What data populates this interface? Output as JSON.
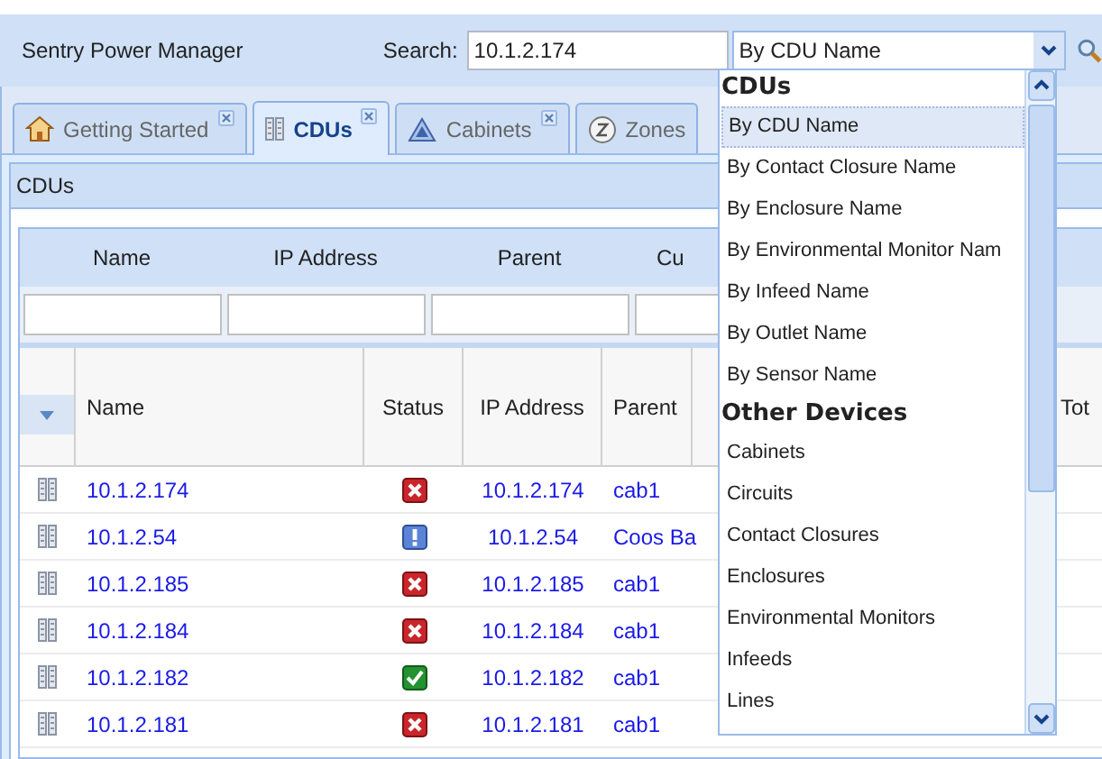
{
  "app_title": "Sentry Power Manager",
  "search": {
    "label": "Search:",
    "value": "10.1.2.174"
  },
  "search_type": {
    "value": "By CDU Name"
  },
  "tabs": [
    {
      "label": "Getting Started",
      "kind": "home",
      "selected": false
    },
    {
      "label": "CDUs",
      "kind": "cdu",
      "selected": true
    },
    {
      "label": "Cabinets",
      "kind": "cabinet",
      "selected": false
    },
    {
      "label": "Zones",
      "kind": "zone",
      "selected": false
    }
  ],
  "panel": {
    "title": "CDUs"
  },
  "filter_columns": [
    "Name",
    "IP Address",
    "Parent",
    "Cu"
  ],
  "grid_columns": [
    "Name",
    "Status",
    "IP Address",
    "Parent",
    "Tot"
  ],
  "rows": [
    {
      "name": "10.1.2.174",
      "kind": "error",
      "ip": "10.1.2.174",
      "parent": "cab1"
    },
    {
      "name": "10.1.2.54",
      "kind": "info",
      "ip": "10.1.2.54",
      "parent": "Coos Ba"
    },
    {
      "name": "10.1.2.185",
      "kind": "error",
      "ip": "10.1.2.185",
      "parent": "cab1"
    },
    {
      "name": "10.1.2.184",
      "kind": "error",
      "ip": "10.1.2.184",
      "parent": "cab1"
    },
    {
      "name": "10.1.2.182",
      "kind": "ok",
      "ip": "10.1.2.182",
      "parent": "cab1"
    },
    {
      "name": "10.1.2.181",
      "kind": "error",
      "ip": "10.1.2.181",
      "parent": "cab1"
    }
  ],
  "dropdown": {
    "groups": [
      {
        "title": "CDUs",
        "items": [
          {
            "label": "By CDU Name",
            "selected": true
          },
          {
            "label": "By Contact Closure Name",
            "selected": false
          },
          {
            "label": "By Enclosure Name",
            "selected": false
          },
          {
            "label": "By Environmental Monitor Nam",
            "selected": false
          },
          {
            "label": "By Infeed Name",
            "selected": false
          },
          {
            "label": "By Outlet Name",
            "selected": false
          },
          {
            "label": "By Sensor Name",
            "selected": false
          }
        ]
      },
      {
        "title": "Other Devices",
        "items": [
          {
            "label": "Cabinets",
            "selected": false
          },
          {
            "label": "Circuits",
            "selected": false
          },
          {
            "label": "Contact Closures",
            "selected": false
          },
          {
            "label": "Enclosures",
            "selected": false
          },
          {
            "label": "Environmental Monitors",
            "selected": false
          },
          {
            "label": "Infeeds",
            "selected": false
          },
          {
            "label": "Lines",
            "selected": false
          }
        ]
      }
    ]
  }
}
